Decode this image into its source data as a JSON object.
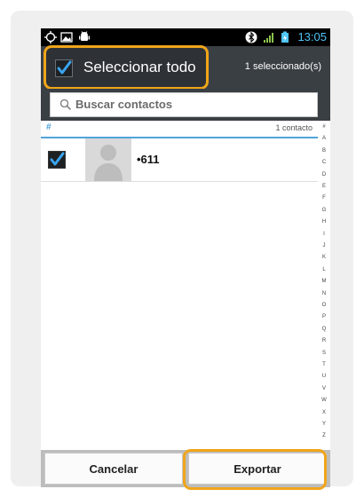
{
  "status_bar": {
    "time": "13:05",
    "icons": [
      "location-icon",
      "image-icon",
      "android-icon",
      "bluetooth-icon",
      "signal-icon",
      "battery-icon"
    ]
  },
  "header": {
    "select_all_label": "Seleccionar todo",
    "selection_count": "1 seleccionado(s)"
  },
  "search": {
    "placeholder": "Buscar contactos"
  },
  "section": {
    "header": "#",
    "count": "1 contacto"
  },
  "contacts": [
    {
      "name": "•611",
      "checked": true
    }
  ],
  "alpha_index": [
    "#",
    "A",
    "B",
    "C",
    "D",
    "E",
    "F",
    "G",
    "H",
    "I",
    "J",
    "K",
    "L",
    "M",
    "N",
    "O",
    "P",
    "Q",
    "R",
    "S",
    "T",
    "U",
    "V",
    "W",
    "X",
    "Y",
    "Z"
  ],
  "buttons": {
    "cancel": "Cancelar",
    "export": "Exportar"
  },
  "colors": {
    "accent": "#4fa3d9",
    "highlight": "#f0a51a",
    "header_bg": "#3a3f44"
  }
}
